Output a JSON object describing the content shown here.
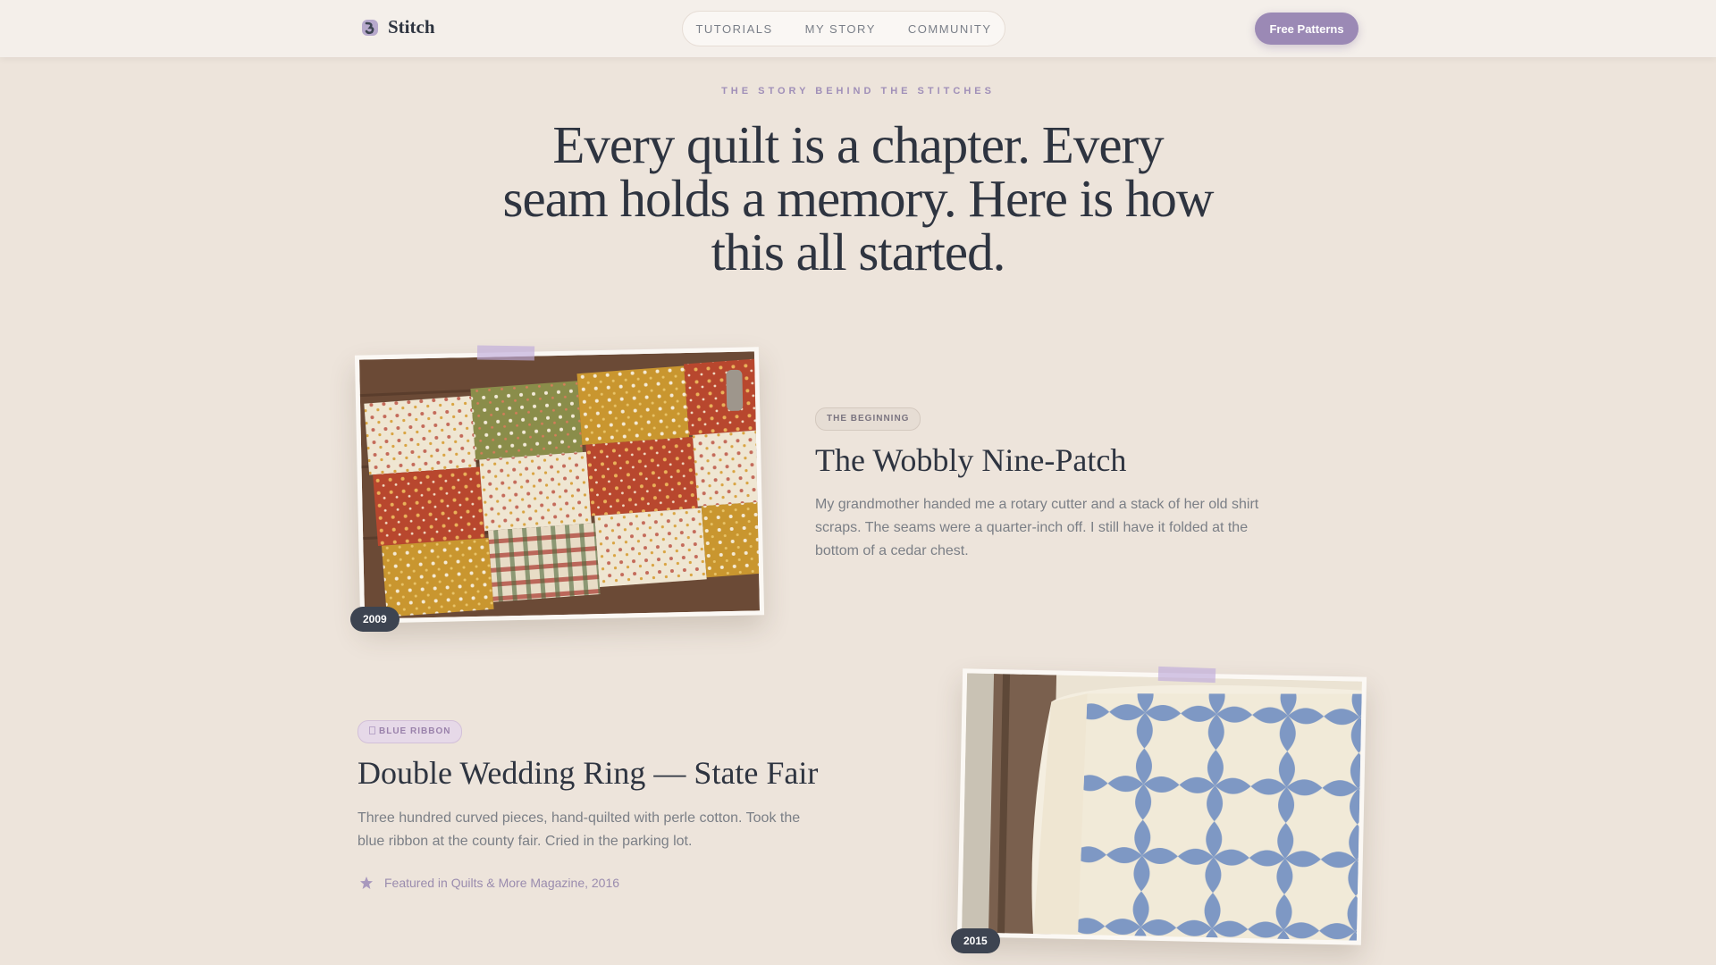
{
  "brand": {
    "name": "Stitch"
  },
  "nav": {
    "links": [
      "TUTORIALS",
      "MY STORY",
      "COMMUNITY"
    ],
    "cta_label": "Free Patterns"
  },
  "hero": {
    "eyebrow": "THE STORY BEHIND THE STITCHES",
    "headline": "Every quilt is a chapter. Every seam holds a memory. Here is how this all started."
  },
  "timeline": [
    {
      "year": "2009",
      "tag": "THE BEGINNING",
      "title": "The Wobbly Nine-Patch",
      "body": "My grandmother handed me a rotary cutter and a stack of her old shirt scraps. The seams were a quarter-inch off. I still have it folded at the bottom of a cedar chest."
    },
    {
      "year": "2015",
      "tag": "BLUE RIBBON",
      "tag_icon": "ribbon-icon",
      "title": "Double Wedding Ring — State Fair",
      "body": "Three hundred curved pieces, hand-quilted with perle cotton. Took the blue ribbon at the county fair. Cried in the parking lot.",
      "feature": "Featured in Quilts & More Magazine, 2016",
      "feature_icon": "star-icon"
    }
  ],
  "colors": {
    "accent": "#9b89b5",
    "background": "#ede4db",
    "ink": "#2e3440",
    "muted": "#7b7f86"
  }
}
